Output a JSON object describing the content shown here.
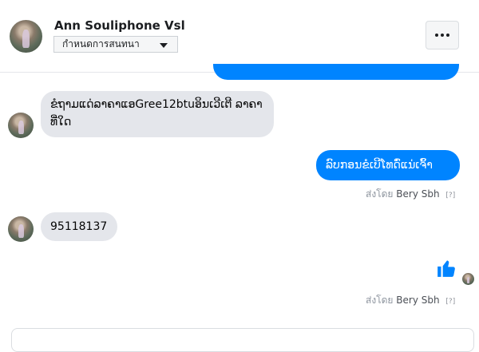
{
  "header": {
    "name": "Ann Souliphone Vsl",
    "settings_label": "กำหนดการสนทนา"
  },
  "messages": {
    "m1_text": "ຂໍຖາມແດ່ລາຄາແອGree12btuອິນເວີເຕີ ລາຄາທີ່ໃດ",
    "m2_text": "ລົບກອນຂໍເບີໂທດົ່ແນ່ເຈົ້າ",
    "m3_text": "95118137"
  },
  "sent_by": {
    "prefix": "ส่งโดย",
    "who": "Bery Sbh",
    "help": "[?]"
  },
  "colors": {
    "accent": "#0084ff",
    "incoming_bg": "#e4e6eb"
  }
}
